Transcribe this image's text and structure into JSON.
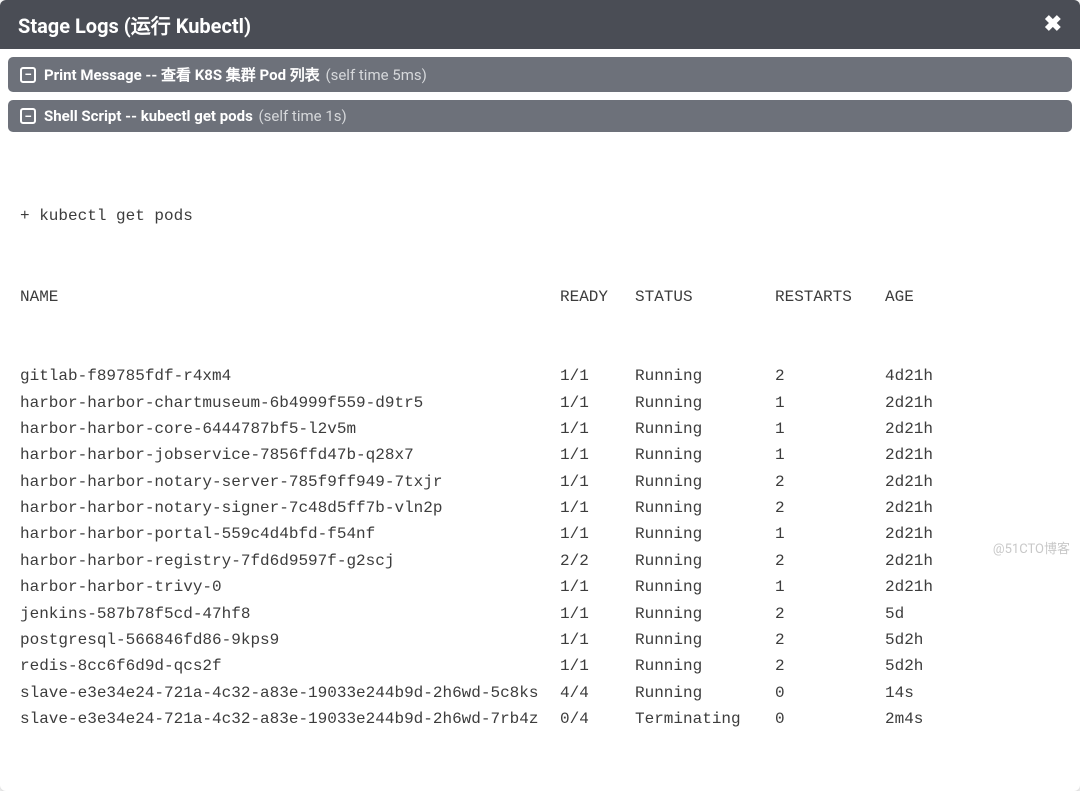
{
  "header": {
    "title": "Stage Logs (运行 Kubectl)",
    "close_glyph": "✖"
  },
  "stages": [
    {
      "icon": "–",
      "main": "Print Message -- ",
      "extra": "查看 K8S 集群 Pod 列表",
      "time": " (self time 5ms)"
    },
    {
      "icon": "–",
      "main": "Shell Script -- ",
      "extra": "kubectl get pods",
      "time": " (self time 1s)"
    }
  ],
  "console": {
    "command": "+ kubectl get pods",
    "headers": {
      "name": "NAME",
      "ready": "READY",
      "status": "STATUS",
      "restarts": "RESTARTS",
      "age": "AGE"
    },
    "rows": [
      {
        "name": "gitlab-f89785fdf-r4xm4",
        "ready": "1/1",
        "status": "Running",
        "restarts": "2",
        "age": "4d21h"
      },
      {
        "name": "harbor-harbor-chartmuseum-6b4999f559-d9tr5",
        "ready": "1/1",
        "status": "Running",
        "restarts": "1",
        "age": "2d21h"
      },
      {
        "name": "harbor-harbor-core-6444787bf5-l2v5m",
        "ready": "1/1",
        "status": "Running",
        "restarts": "1",
        "age": "2d21h"
      },
      {
        "name": "harbor-harbor-jobservice-7856ffd47b-q28x7",
        "ready": "1/1",
        "status": "Running",
        "restarts": "1",
        "age": "2d21h"
      },
      {
        "name": "harbor-harbor-notary-server-785f9ff949-7txjr",
        "ready": "1/1",
        "status": "Running",
        "restarts": "2",
        "age": "2d21h"
      },
      {
        "name": "harbor-harbor-notary-signer-7c48d5ff7b-vln2p",
        "ready": "1/1",
        "status": "Running",
        "restarts": "2",
        "age": "2d21h"
      },
      {
        "name": "harbor-harbor-portal-559c4d4bfd-f54nf",
        "ready": "1/1",
        "status": "Running",
        "restarts": "1",
        "age": "2d21h"
      },
      {
        "name": "harbor-harbor-registry-7fd6d9597f-g2scj",
        "ready": "2/2",
        "status": "Running",
        "restarts": "2",
        "age": "2d21h"
      },
      {
        "name": "harbor-harbor-trivy-0",
        "ready": "1/1",
        "status": "Running",
        "restarts": "1",
        "age": "2d21h"
      },
      {
        "name": "jenkins-587b78f5cd-47hf8",
        "ready": "1/1",
        "status": "Running",
        "restarts": "2",
        "age": "5d"
      },
      {
        "name": "postgresql-566846fd86-9kps9",
        "ready": "1/1",
        "status": "Running",
        "restarts": "2",
        "age": "5d2h"
      },
      {
        "name": "redis-8cc6f6d9d-qcs2f",
        "ready": "1/1",
        "status": "Running",
        "restarts": "2",
        "age": "5d2h"
      },
      {
        "name": "slave-e3e34e24-721a-4c32-a83e-19033e244b9d-2h6wd-5c8ks",
        "ready": "4/4",
        "status": "Running",
        "restarts": "0",
        "age": "14s"
      },
      {
        "name": "slave-e3e34e24-721a-4c32-a83e-19033e244b9d-2h6wd-7rb4z",
        "ready": "0/4",
        "status": "Terminating",
        "restarts": "0",
        "age": "2m4s"
      }
    ]
  },
  "watermark": "@51CTO博客"
}
